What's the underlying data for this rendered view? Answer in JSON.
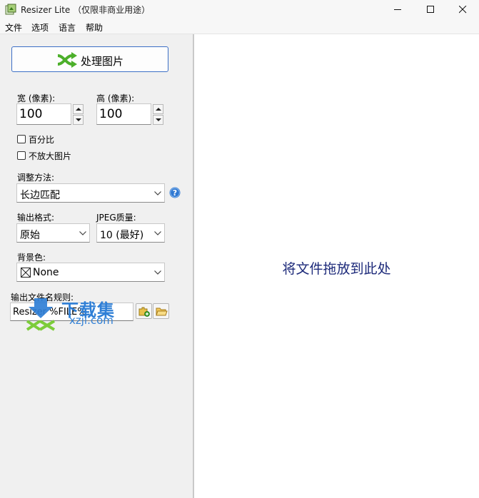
{
  "window": {
    "title": "Resizer Lite （仅限非商业用途）"
  },
  "menu": [
    "文件",
    "选项",
    "语言",
    "帮助"
  ],
  "process_button": {
    "label": "处理图片"
  },
  "width": {
    "label": "宽 (像素):",
    "value": "100"
  },
  "height": {
    "label": "高 (像素):",
    "value": "100"
  },
  "checkboxes": {
    "percent": {
      "label": "百分比",
      "checked": false
    },
    "no_enlarge": {
      "label": "不放大图片",
      "checked": false
    }
  },
  "adjust": {
    "label": "调整方法:",
    "value": "长边匹配"
  },
  "output_format": {
    "label": "输出格式:",
    "value": "原始"
  },
  "jpeg_quality": {
    "label": "JPEG质量:",
    "value": "10 (最好)"
  },
  "background": {
    "label": "背景色:",
    "value": "None"
  },
  "filename_rule": {
    "label": "输出文件名规则:",
    "value": "Resizer %FILE%"
  },
  "drop_zone": {
    "text": "将文件拖放到此处"
  },
  "watermark": {
    "text": "下载集",
    "url": "xzji.com"
  },
  "colors": {
    "accent": "#3c6fc6",
    "drop_text": "#1d2a7a",
    "panel": "#f0f0f0"
  }
}
